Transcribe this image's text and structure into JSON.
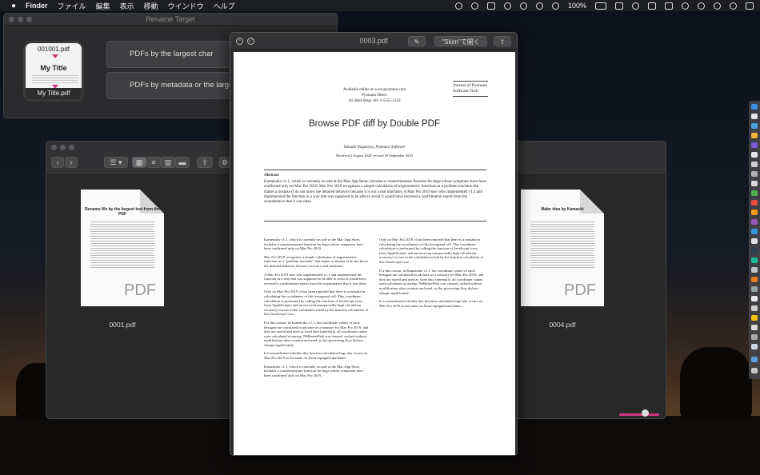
{
  "menubar": {
    "apple": "",
    "app_name": "Finder",
    "items": [
      "ファイル",
      "編集",
      "表示",
      "移動",
      "ウインドウ",
      "ヘルプ"
    ],
    "battery": "100%"
  },
  "rename_window": {
    "title": "Rename Target",
    "icon_top": "001001.pdf",
    "icon_title": "My Title",
    "icon_bottom": "My Title.pdf",
    "buttons": [
      "PDFs by the largest char",
      "PDFs by metadata or the larges"
    ]
  },
  "finder": {
    "files": [
      {
        "label": "0001.pdf",
        "thumb_title": "Rename file by the largest text from the PDF",
        "mark": "PDF"
      },
      {
        "label": "0004.pdf",
        "thumb_title": "Make idea by Kamachi",
        "mark": "PDF"
      }
    ]
  },
  "quicklook": {
    "title": "0003.pdf",
    "open_button": "\"Skim\"で開く",
    "document": {
      "available": "Available online at www.pyomaru.com",
      "publisher": "Pyomaru Direct",
      "address": "AS Holz Blog +81-3-5555-1333",
      "journal": "Journal of Pyomaru Software Tech",
      "title": "Browse PDF diff by Double PDF",
      "authors": "Takaaki Naganoya, Pyomaru Software",
      "received": "Received 2 August 2020; revised 20 September 2020",
      "abstract_heading": "Abstract",
      "abstract_text": "Kamenoko v1.1, which is currently on sale at the Mac App Store, includes a countermeasure function for bugs whose symptoms have been confirmed only on Mac Pro 2019. Mac Pro 2019 recognizes a simple calculation of trigonometric functions as a problem machine that makes a mistake (I do not know the detailed behavior because it is not a real machine). A Mac Pro 2019 user who implemented v1.1 and implemented the function in a way that was supposed to be able to avoid it would have received a confirmation report from the acquaintance that it was okay.",
      "col_left": [
        "Kamenoko v1.1, which is currently on sale at the Mac App Store, includes a countermeasure function for bugs whose symptoms have been confirmed only on Mac Pro 2019.",
        "Mac Pro 2019 recognizes a simple calculation of trigonometric functions as a \"problem machine\" that makes a mistake (I do not know the detailed behavior because it is not a real machine).",
        "A Mac Pro 2019 user who implemented v1.1 and implemented the function in a way that was supposed to be able to avoid it would have received a confirmation report from the acquaintance that it was okay.",
        "Only on Mac Pro 2019, it has been reported that there is a mistake in calculating the coordinates of this hexagonal cell. This coordinate calculation is performed by calling the function of JavaScript (core from AppleScript), and an error (an unexpectedly high calculation accuracy) occurs in the calculation result by the function calculation of this JavaScript Core.",
        "For this reason, in Kamenoko v1.1, the coordinate values of each hexagon are calculated in advance as a measure for Mac Pro 2019, and they are stored and used as fixed data (internally, all coordinate values were calculated at startup, NSBezierPath was created, cached without modification after creation and used, so the processing flow did not change significantly.",
        "It is unconfirmed whether this function calculation bug only occurs on Mac Pro 2019 or the same on Xeon-equipped machines.",
        "Kamenoko v1.1, which is currently on sale at the Mac App Store, includes a countermeasure function for bugs whose symptoms have been confirmed only on Mac Pro 2019."
      ],
      "col_right": [
        "Only on Mac Pro 2019, it has been reported that there is a mistake in calculating the coordinates of this hexagonal cell. This coordinate calculation is performed by calling the function of JavaScript (core from AppleScript), and an error (an unexpectedly high calculation accuracy) occurs in the calculation result by the function calculation of this JavaScript Core.",
        "For this reason, in Kamenoko v1.1, the coordinate values of each hexagon are calculated in advance as a measure for Mac Pro 2019, and they are stored and used as fixed data (internally, all coordinate values were calculated at startup, NSBezierPath was created, cached without modification after creation and used, so the processing flow did not change significantly.",
        "It is unconfirmed whether this function calculation bug only occurs on Mac Pro 2019 or the same on Xeon-equipped machines."
      ]
    }
  },
  "colors": {
    "accent": "#d2357c",
    "window_bg": "#2b2b2d",
    "titlebar": "#333336"
  }
}
